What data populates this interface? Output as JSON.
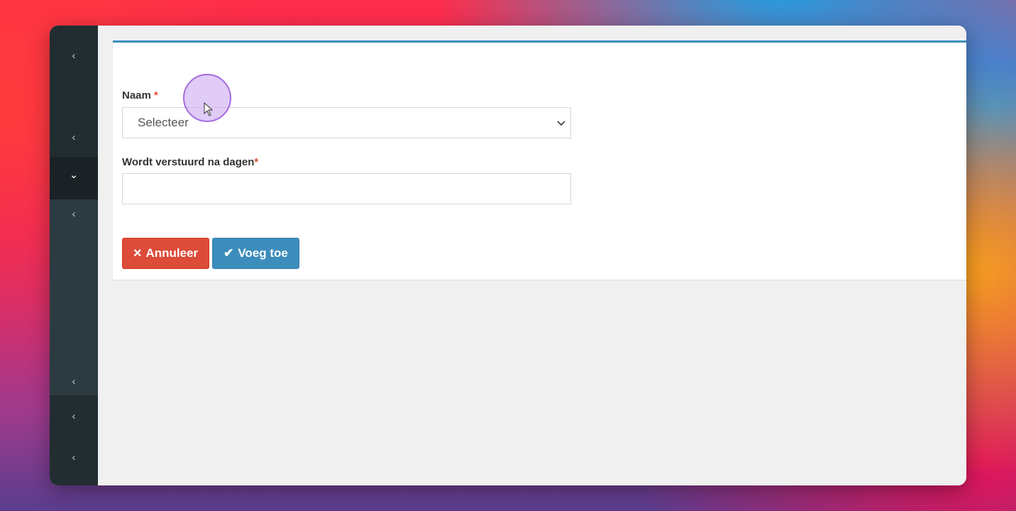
{
  "sidebar": {
    "items": [
      {
        "icon": "chevron-left-icon",
        "glyph": "‹"
      },
      {
        "icon": "chevron-left-icon",
        "glyph": "‹"
      },
      {
        "icon": "chevron-down-icon",
        "glyph": "⌄"
      },
      {
        "icon": "chevron-left-icon",
        "glyph": "‹"
      },
      {
        "icon": "chevron-left-icon",
        "glyph": "‹"
      },
      {
        "icon": "chevron-left-icon",
        "glyph": "‹"
      },
      {
        "icon": "chevron-left-icon",
        "glyph": "‹"
      }
    ]
  },
  "form": {
    "name_label": "Naam",
    "required_mark": "*",
    "name_select_value": "Selecteer",
    "days_label": "Wordt verstuurd na dagen",
    "days_value": "",
    "cancel_label": "Annuleer",
    "cancel_icon": "×",
    "add_label": "Voeg toe",
    "add_icon": "✔"
  },
  "colors": {
    "accent": "#3c8dbc",
    "danger": "#dd4b39",
    "sidebar_bg": "#222d32"
  }
}
